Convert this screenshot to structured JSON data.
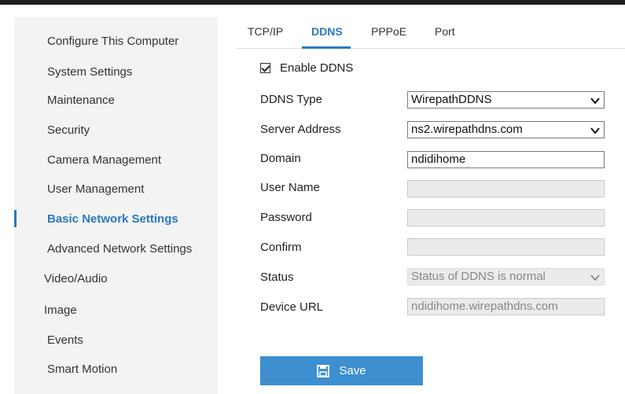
{
  "sidebar": {
    "items": [
      {
        "label": "Configure This Computer"
      },
      {
        "label": "System Settings"
      },
      {
        "label": "Maintenance"
      },
      {
        "label": "Security"
      },
      {
        "label": "Camera Management"
      },
      {
        "label": "User Management"
      },
      {
        "label": "Basic Network Settings",
        "active": true
      },
      {
        "label": "Advanced Network Settings"
      },
      {
        "label": "Video/Audio"
      },
      {
        "label": "Image"
      },
      {
        "label": "Events"
      },
      {
        "label": "Smart Motion"
      }
    ]
  },
  "tabs": [
    {
      "label": "TCP/IP"
    },
    {
      "label": "DDNS",
      "active": true
    },
    {
      "label": "PPPoE"
    },
    {
      "label": "Port"
    }
  ],
  "form": {
    "enable_ddns": {
      "label": "Enable DDNS",
      "checked": true
    },
    "ddns_type": {
      "label": "DDNS Type",
      "value": "WirepathDDNS"
    },
    "server_address": {
      "label": "Server Address",
      "value": "ns2.wirepathdns.com"
    },
    "domain": {
      "label": "Domain",
      "value": "ndidihome"
    },
    "user_name": {
      "label": "User Name",
      "value": ""
    },
    "password": {
      "label": "Password",
      "value": ""
    },
    "confirm": {
      "label": "Confirm",
      "value": ""
    },
    "status": {
      "label": "Status",
      "value": "Status of DDNS is normal"
    },
    "device_url": {
      "label": "Device URL",
      "value": "ndidihome.wirepathdns.com"
    }
  },
  "actions": {
    "save_label": "Save"
  },
  "colors": {
    "accent": "#2a78c0",
    "button": "#3d8fd0",
    "topbar": "#1f1f1f",
    "sidebar_bg": "#f3f3f3"
  }
}
